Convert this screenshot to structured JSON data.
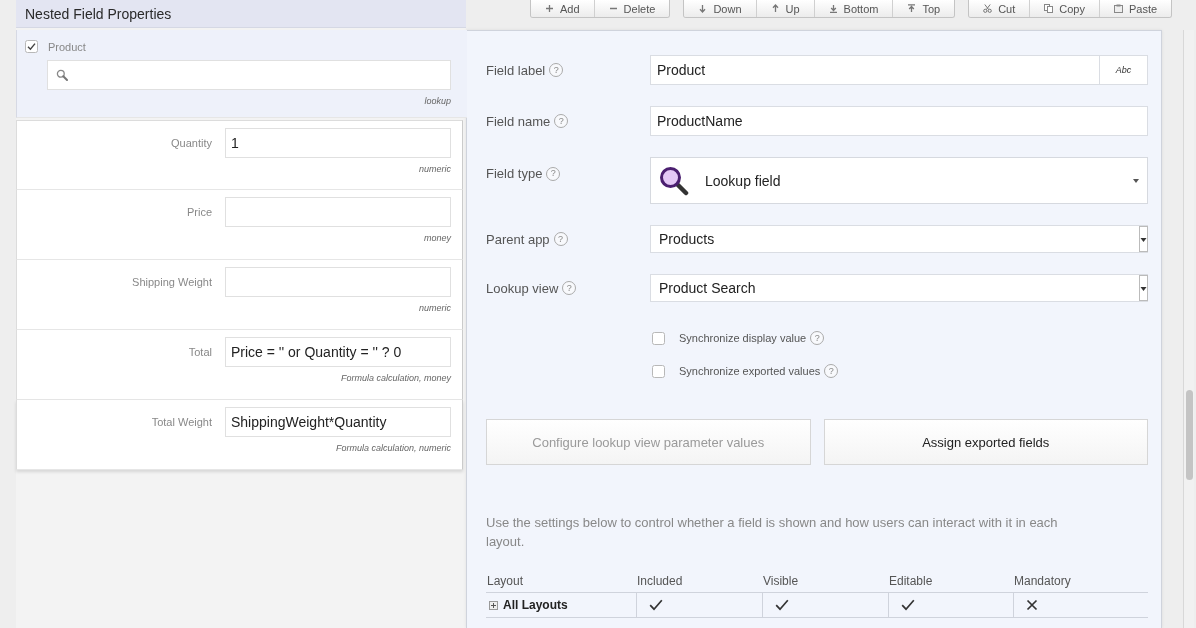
{
  "left_panel": {
    "title": "Nested Field Properties",
    "fields": [
      {
        "kind": "lookup",
        "label": "Product",
        "checked": true,
        "selected": true,
        "note": "lookup"
      },
      {
        "kind": "text",
        "label": "Quantity",
        "value": "1",
        "selected": false,
        "note": "numeric"
      },
      {
        "kind": "text",
        "label": "Price",
        "selected": false,
        "note": "money"
      },
      {
        "kind": "text",
        "label": "Shipping Weight",
        "selected": false,
        "note": "numeric"
      },
      {
        "kind": "text",
        "label": "Total",
        "value": "Price = '' or Quantity = '' ? 0",
        "selected": false,
        "note": "Formula calculation, money"
      },
      {
        "kind": "text",
        "label": "Total Weight",
        "value": "ShippingWeight*Quantity",
        "selected": false,
        "note": "Formula calculation, numeric"
      }
    ]
  },
  "toolbar": {
    "groups": [
      {
        "buttons": [
          {
            "kind": "add",
            "label": "Add"
          },
          {
            "kind": "delete",
            "label": "Delete"
          }
        ]
      },
      {
        "buttons": [
          {
            "kind": "down",
            "label": "Down"
          },
          {
            "kind": "up",
            "label": "Up"
          },
          {
            "kind": "bottom",
            "label": "Bottom"
          },
          {
            "kind": "top",
            "label": "Top"
          }
        ]
      },
      {
        "buttons": [
          {
            "kind": "cut",
            "label": "Cut"
          },
          {
            "kind": "copy",
            "label": "Copy"
          },
          {
            "kind": "paste",
            "label": "Paste"
          }
        ]
      }
    ]
  },
  "properties": {
    "rows": [
      {
        "kind": "input",
        "label": "Field label",
        "help": "?",
        "value": "Product",
        "button": "Abc"
      },
      {
        "kind": "input",
        "label": "Field name",
        "help": "?",
        "value": "ProductName"
      },
      {
        "kind": "type",
        "label": "Field type",
        "help": "?",
        "value": "Lookup field"
      },
      {
        "kind": "select",
        "label": "Parent app",
        "help": "?",
        "value": "Products"
      },
      {
        "kind": "select",
        "label": "Lookup view",
        "help": "?",
        "value": "Product Search"
      }
    ],
    "options": [
      {
        "label": "Synchronize display value",
        "help": "?",
        "checked": false
      },
      {
        "label": "Synchronize exported values",
        "help": "?",
        "checked": false
      }
    ],
    "actions": [
      {
        "label": "Configure lookup view parameter values",
        "disabled": true
      },
      {
        "label": "Assign exported fields",
        "disabled": false
      }
    ],
    "hint": "Use the settings below to control whether a field is shown and how users can interact with it in each layout.",
    "layout_table": {
      "columns": [
        "Layout",
        "Included",
        "Visible",
        "Editable",
        "Mandatory"
      ],
      "rows": [
        {
          "name": "All Layouts",
          "expanded": false,
          "cells": [
            {
              "checked": true
            },
            {
              "checked": true
            },
            {
              "checked": true
            },
            {
              "checked": false
            }
          ]
        }
      ]
    }
  }
}
